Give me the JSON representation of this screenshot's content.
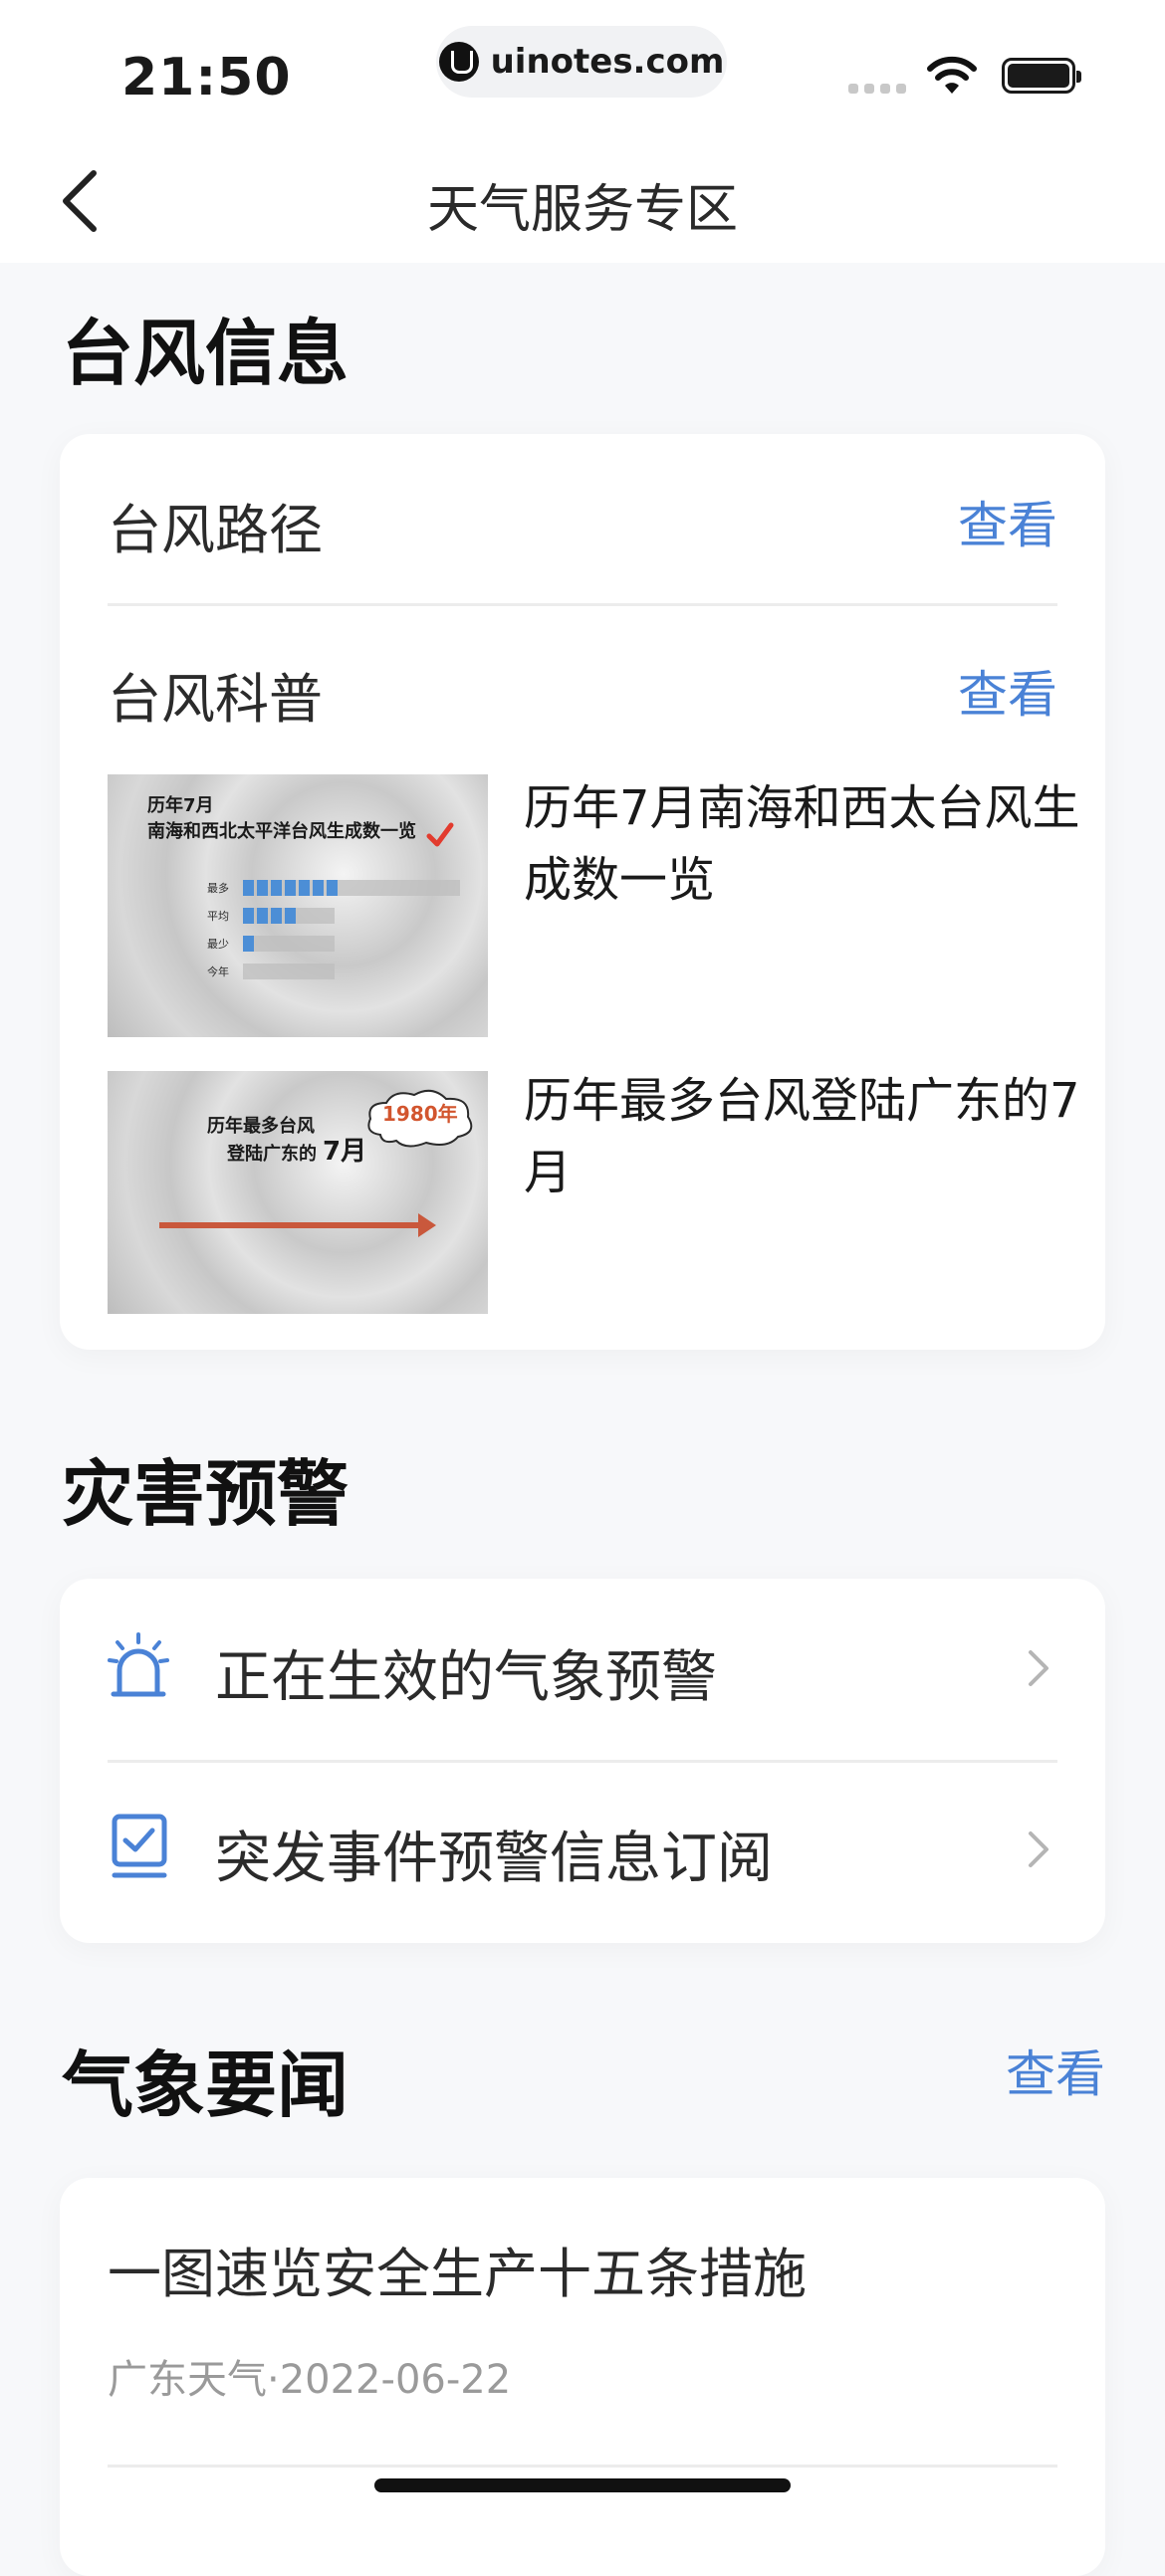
{
  "status_bar": {
    "time": "21:50",
    "url": "uinotes.com"
  },
  "nav": {
    "title": "天气服务专区"
  },
  "typhoon_section": {
    "title": "台风信息",
    "track_label": "台风路径",
    "track_link": "查看",
    "science_label": "台风科普",
    "science_link": "查看",
    "articles": [
      {
        "title": "历年7月南海和西太台风生成数一览",
        "thumb_line1": "历年7月",
        "thumb_line2": "南海和西北太平洋台风生成数一览",
        "thumb_rows": [
          "最多",
          "平均",
          "最少",
          "今年"
        ],
        "thumb_counts": [
          7,
          4,
          1,
          0
        ]
      },
      {
        "title": "历年最多台风登陆广东的7月",
        "thumb_line1": "历年最多台风",
        "thumb_line2": "登陆广东的",
        "thumb_month": "7月",
        "thumb_badge": "1980年"
      }
    ]
  },
  "warning_section": {
    "title": "灾害预警",
    "items": [
      {
        "label": "正在生效的气象预警",
        "icon": "alarm-light-icon"
      },
      {
        "label": "突发事件预警信息订阅",
        "icon": "subscribe-check-icon"
      }
    ]
  },
  "news_section": {
    "title": "气象要闻",
    "link": "查看",
    "items": [
      {
        "title": "一图速览安全生产十五条措施",
        "meta": "广东天气·2022-06-22"
      }
    ]
  },
  "colors": {
    "accent": "#4a82d6",
    "background": "#f7f8fa"
  }
}
